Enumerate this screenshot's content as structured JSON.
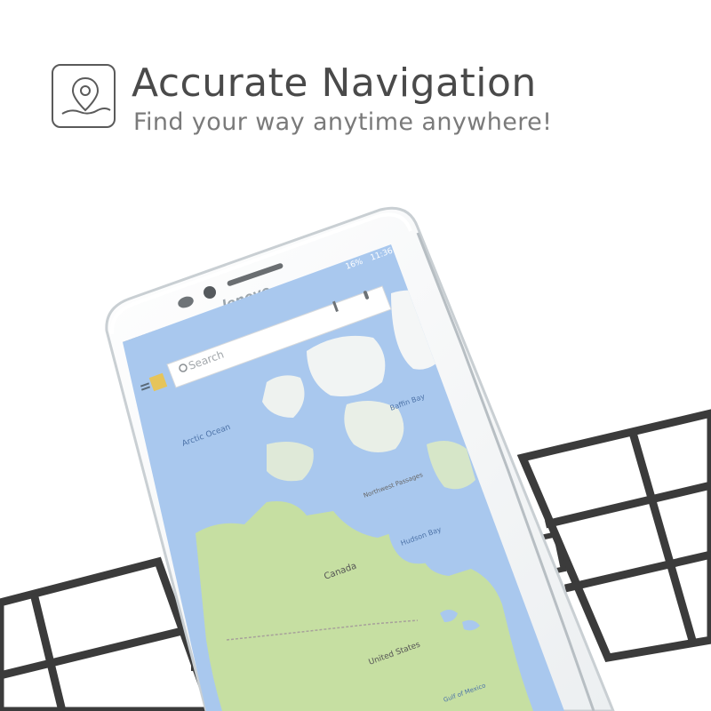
{
  "header": {
    "title": "Accurate Navigation",
    "subtitle": "Find your way anytime anywhere!",
    "icon": "map-pin-icon"
  },
  "phone": {
    "brand": "lenovo",
    "status_bar": {
      "battery": "16%",
      "time": "11:36"
    },
    "search": {
      "placeholder": "Search"
    }
  },
  "map": {
    "labels": {
      "arctic_ocean": "Arctic Ocean",
      "baffin_bay": "Baffin Bay",
      "northwest_passages": "Northwest Passages",
      "hudson_bay": "Hudson Bay",
      "canada": "Canada",
      "united_states": "United States",
      "gulf_of_mexico": "Gulf of Mexico"
    }
  },
  "colors": {
    "ocean": "#a9c8ee",
    "land": "#c6dfa2",
    "ice": "#f4f6f6",
    "frame": "#3b3b3b",
    "text": "#4a4a4a"
  }
}
